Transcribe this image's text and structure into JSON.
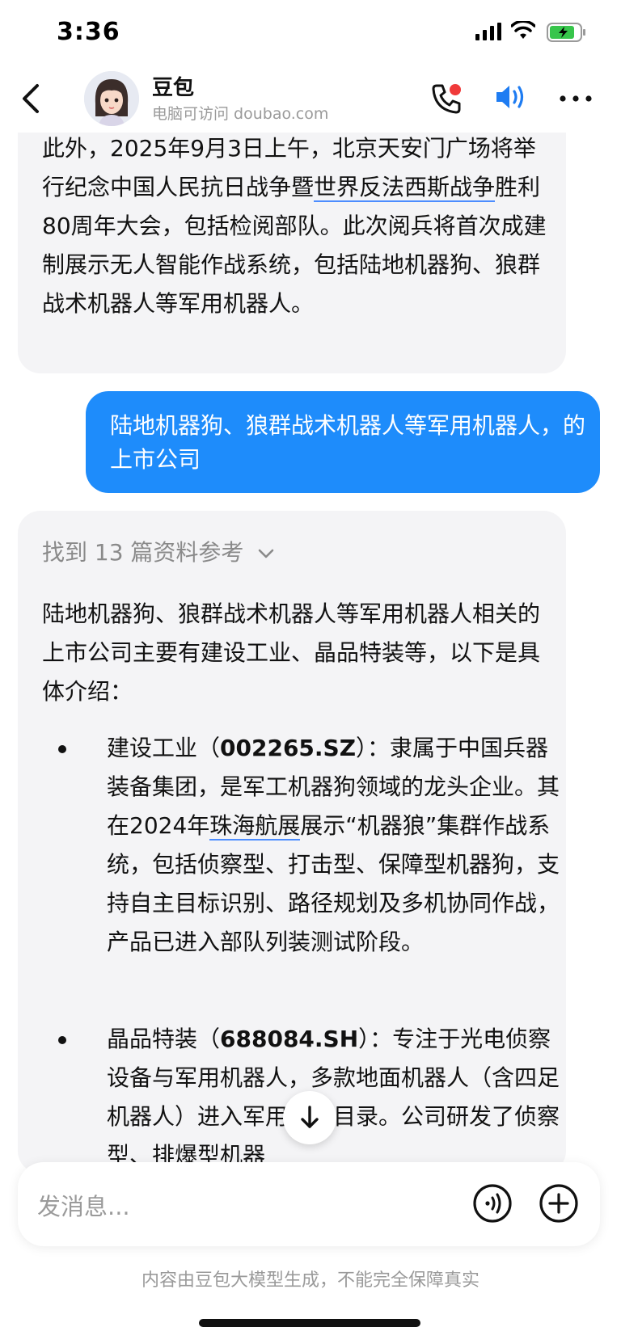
{
  "status_bar": {
    "time": "3:36"
  },
  "header": {
    "name": "豆包",
    "subtitle": "电脑可访问 doubao.com"
  },
  "messages": [
    {
      "role": "assistant",
      "text_parts": [
        "此外，2025年9月3日上午，北京天安门广场将举行纪念中国人民抗日战争暨",
        "世界反法西斯战争",
        "胜利80周年大会，包括检阅部队。此次阅兵将首次成建制展示无人智能作战系统，包括陆地机器狗、狼群战术机器人等军用机器人。"
      ]
    },
    {
      "role": "user",
      "text": "陆地机器狗、狼群战术机器人等军用机器人，的上市公司"
    },
    {
      "role": "assistant",
      "refs_label": "找到 13 篇资料参考",
      "intro": "陆地机器狗、狼群战术机器人等军用机器人相关的上市公司主要有建设工业、晶品特装等，以下是具体介绍：",
      "bullets": [
        {
          "name": "建设工业（",
          "code": "002265.SZ",
          "after_code": "）：隶属于中国兵器装备集团，是军工机器狗领域的龙头企业。其在2024年",
          "link": "珠海航展",
          "rest": "展示“机器狼”集群作战系统，包括侦察型、打击型、保障型机器狗，支持自主目标识别、路径规划及多机协同作战，产品已进入部队列装测试阶段。"
        },
        {
          "name": "晶品特装（",
          "code": "688084.SH",
          "after_code": "）：专注于光电侦察设备与军用机器人，多款地面机器人（含四足机器人）进入军用采购目录。公司研发了侦察型、排爆型机器",
          "link": "",
          "rest": ""
        }
      ]
    }
  ],
  "input": {
    "placeholder": "发消息..."
  },
  "disclaimer": "内容由豆包大模型生成，不能完全保障真实",
  "colors": {
    "user_bubble": "#1e8cfb",
    "assistant_bubble": "#f4f4f6",
    "accent": "#1e7cf2",
    "notification_dot": "#f03a3a"
  },
  "icons": [
    "back-icon",
    "avatar",
    "phone-icon",
    "speaker-icon",
    "more-icon",
    "chevron-down-icon",
    "arrow-down-icon",
    "voice-icon",
    "plus-icon",
    "signal-icon",
    "wifi-icon",
    "battery-icon"
  ]
}
